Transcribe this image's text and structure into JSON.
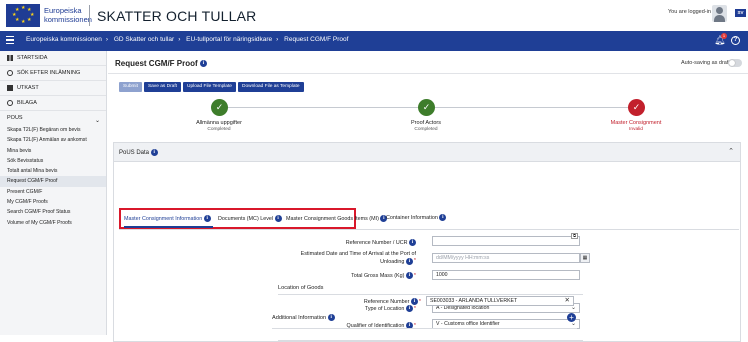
{
  "header": {
    "org_line1": "Europeiska",
    "org_line2": "kommissionen",
    "app_title": "SKATTER OCH TULLAR",
    "logged_in_text": "You are logged-in as",
    "lang": "SV"
  },
  "navbar": {
    "breadcrumbs": [
      "Europeiska kommissionen",
      "GD Skatter och tullar",
      "EU-tullportal för näringsidkare",
      "Request CGM/F Proof"
    ],
    "notification_count": "1",
    "help_glyph": "?"
  },
  "sidebar": {
    "main_items": [
      {
        "label": "STARTSIDA",
        "icon": "grid-icon"
      },
      {
        "label": "SÖK EFTER INLÄMNING",
        "icon": "search-icon"
      },
      {
        "label": "UTKAST",
        "icon": "draft-icon"
      },
      {
        "label": "BILAGA",
        "icon": "attachment-icon"
      }
    ],
    "group_label": "POUS",
    "sub_items": [
      "Skapa T2L(F) Begäran om bevis",
      "Skapa T2L(F) Anmälan av ankomst",
      "Mina bevis",
      "Sök Bevisstatus",
      "Totalt antal Mina bevis",
      "Request CGM/F Proof",
      "Present CGM/F",
      "My CGM/F Proofs",
      "Search CGM/F Proof Status",
      "Volume of My CGM/F Proofs"
    ],
    "active_sub_item": "Request CGM/F Proof"
  },
  "main": {
    "title": "Request CGM/F Proof",
    "autosave_label": "Auto-saving as draft",
    "toolbar": {
      "submit": "Submit",
      "save_draft": "Save as Draft",
      "upload_template": "Upload File Template",
      "download_template": "Download File as Template"
    },
    "steps": [
      {
        "label": "Allmänna uppgifter",
        "status": "Completed",
        "state": "ok"
      },
      {
        "label": "Proof Actors",
        "status": "Completed",
        "state": "ok"
      },
      {
        "label": "Master Consignment",
        "status": "Invalid",
        "state": "err"
      }
    ],
    "panel_title": "PoUS Data",
    "tabs": [
      "Master Consignment Information",
      "Documents (MC) Level",
      "Master Consignment Goods Items (MI)",
      "Container Information"
    ],
    "form": {
      "reference_label": "Reference Number / UCR",
      "reference_value": "",
      "eta_label": "Estimated Date and Time of Arrival at the Port of Unloading",
      "eta_placeholder": "dd/MM/yyyy HH:mm:ss",
      "mass_label": "Total Gross Mass (Kg)",
      "mass_value": "1000",
      "location_section": "Location of Goods",
      "type_label": "Type of Location",
      "type_value": "A - Designated location",
      "qualifier_label": "Qualifier of Identification",
      "qualifier_value": "V - Customs office Identifier",
      "ref_number_label": "Reference Number",
      "ref_number_value": "SE003033 - ARLANDA TULLVERKET",
      "additional_label": "Additional Information"
    }
  },
  "colors": {
    "brand_blue": "#1f3f96",
    "success": "#3e7d2b",
    "error": "#c2202c",
    "highlight_box": "#d9182b"
  }
}
